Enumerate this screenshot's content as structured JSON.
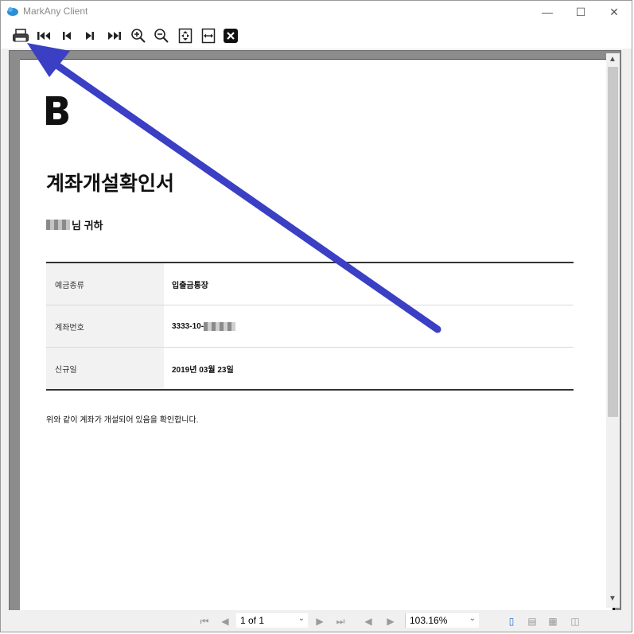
{
  "window": {
    "title": "MarkAny Client"
  },
  "toolbar": {
    "buttons": [
      {
        "name": "print"
      },
      {
        "name": "first-page"
      },
      {
        "name": "previous-page"
      },
      {
        "name": "next-page"
      },
      {
        "name": "last-page"
      },
      {
        "name": "zoom-in"
      },
      {
        "name": "zoom-out"
      },
      {
        "name": "fit-page"
      },
      {
        "name": "fit-width"
      },
      {
        "name": "close"
      }
    ]
  },
  "document": {
    "logo_letter": "B",
    "title": "계좌개설확인서",
    "recipient_suffix": "님 귀하",
    "rows": [
      {
        "label": "예금종류",
        "value": "입출금통장"
      },
      {
        "label": "계좌번호",
        "value": "3333-10-"
      },
      {
        "label": "신규일",
        "value": "2019년 03월 23일"
      }
    ],
    "confirmation": "위와 같이 계좌가 개설되어 있음을 확인합니다."
  },
  "statusbar": {
    "page_indicator": "1 of 1",
    "zoom": "103.16%"
  },
  "colors": {
    "annotation_arrow": "#3a3fc4"
  }
}
